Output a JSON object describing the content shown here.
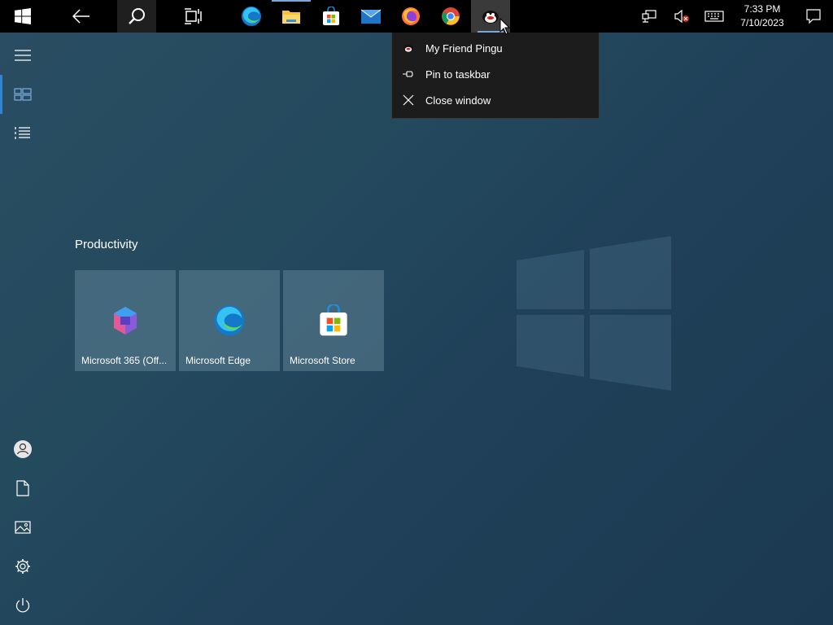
{
  "taskbar": {
    "buttons": [
      {
        "name": "start",
        "icon": "windows-logo-icon"
      },
      {
        "name": "back",
        "icon": "back-arrow-icon"
      },
      {
        "name": "search",
        "icon": "search-icon"
      },
      {
        "name": "task-view",
        "icon": "task-view-icon"
      },
      {
        "name": "edge",
        "icon": "edge-icon"
      },
      {
        "name": "file-explorer",
        "icon": "folder-icon"
      },
      {
        "name": "store",
        "icon": "store-icon"
      },
      {
        "name": "mail",
        "icon": "mail-icon"
      },
      {
        "name": "firefox",
        "icon": "firefox-icon"
      },
      {
        "name": "chrome",
        "icon": "chrome-icon"
      },
      {
        "name": "pingu",
        "icon": "pingu-icon"
      }
    ],
    "clock": {
      "time": "7:33 PM",
      "date": "7/10/2023"
    },
    "accent": "#7aa7d8"
  },
  "jumplist": {
    "items": [
      {
        "label": "My Friend Pingu",
        "icon": "pingu-icon"
      },
      {
        "label": "Pin to taskbar",
        "icon": "pin-icon"
      },
      {
        "label": "Close window",
        "icon": "close-icon"
      }
    ]
  },
  "start": {
    "rail": {
      "top": [
        {
          "icon": "hamburger-icon"
        },
        {
          "icon": "tiles-icon",
          "selected": true
        },
        {
          "icon": "all-apps-list-icon"
        }
      ],
      "bottom": [
        {
          "icon": "user-icon"
        },
        {
          "icon": "document-icon"
        },
        {
          "icon": "pictures-icon"
        },
        {
          "icon": "settings-gear-icon"
        },
        {
          "icon": "power-icon"
        }
      ]
    },
    "group": {
      "title": "Productivity",
      "tiles": [
        {
          "label": "Microsoft 365 (Off...",
          "icon": "microsoft-365-icon"
        },
        {
          "label": "Microsoft Edge",
          "icon": "edge-icon"
        },
        {
          "label": "Microsoft Store",
          "icon": "store-icon"
        }
      ]
    }
  }
}
